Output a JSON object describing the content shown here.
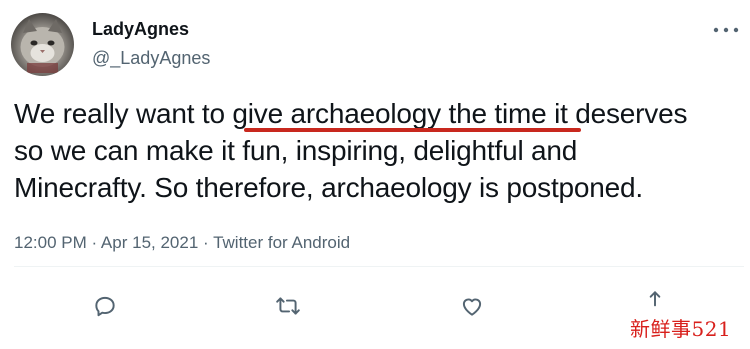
{
  "author": {
    "display_name": "LadyAgnes",
    "handle": "@_LadyAgnes",
    "avatar_icon": "cat-avatar"
  },
  "tweet": {
    "lines": [
      "We really want to give archaeology the time it deserves",
      "so we can make it fun, inspiring, delightful and",
      "Minecrafty. So therefore, archaeology is postponed."
    ],
    "underlined_phrase": "give archaeology the time",
    "meta": "12:00 PM · Apr 15, 2021 · Twitter for Android"
  },
  "actions": [
    "reply-icon",
    "retweet-icon",
    "like-icon",
    "share-icon"
  ],
  "watermark": "新鲜事521",
  "colors": {
    "text": "#0f1419",
    "secondary": "#536471",
    "underline": "#c8281e",
    "watermark": "#d8201c"
  }
}
